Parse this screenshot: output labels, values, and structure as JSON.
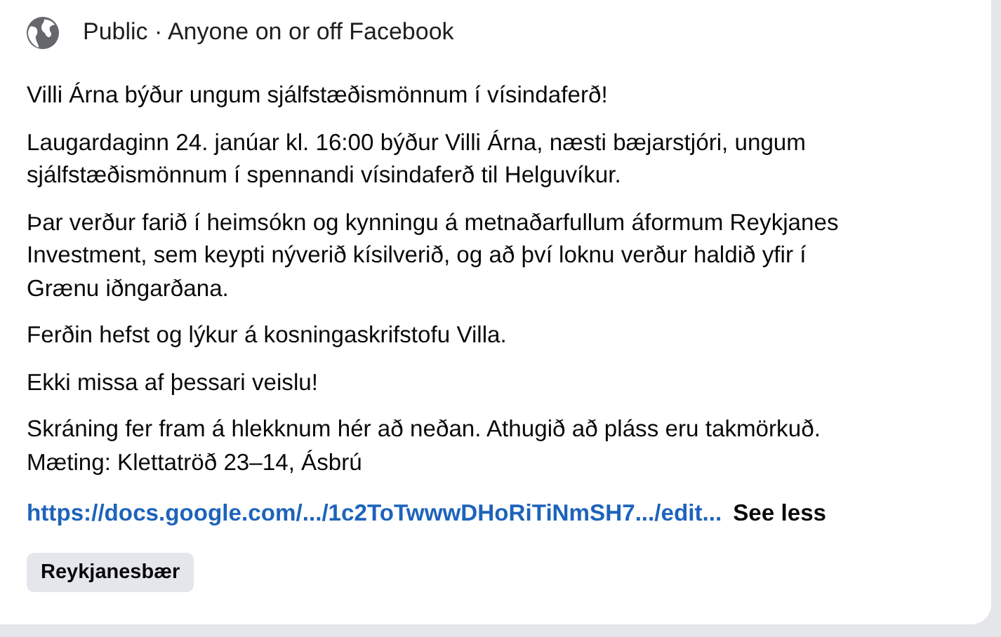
{
  "audience": {
    "label": "Public · Anyone on or off Facebook"
  },
  "paragraphs": [
    {
      "lines": [
        "Villi Árna býður ungum sjálfstæðismönnum í vísindaferð!"
      ]
    },
    {
      "lines": [
        "Laugardaginn 24. janúar kl. 16:00 býður Villi Árna, næsti bæjarstjóri, ungum",
        "sjálfstæðismönnum í spennandi vísindaferð til Helguvíkur."
      ]
    },
    {
      "lines": [
        "Þar verður farið í heimsókn og kynningu á metnaðarfullum áformum Reykjanes",
        "Investment, sem keypti nýverið kísilverið, og að því loknu verður haldið yfir í",
        "Grænu iðngarðana."
      ]
    },
    {
      "lines": [
        "Ferðin hefst og lýkur á kosningaskrifstofu Villa."
      ]
    },
    {
      "lines": [
        "Ekki missa af þessari veislu!"
      ]
    },
    {
      "lines": [
        "Skráning fer fram á hlekknum hér að neðan. Athugið að pláss eru takmörkuð.",
        "Mæting: Klettatröð 23–14, Ásbrú"
      ]
    }
  ],
  "link": {
    "url": "https://docs.google.com/.../1c2ToTwwwDHoRiTiNmSH7.../edit...",
    "toggle": "See less"
  },
  "tags": [
    "Reykjanesbær"
  ]
}
